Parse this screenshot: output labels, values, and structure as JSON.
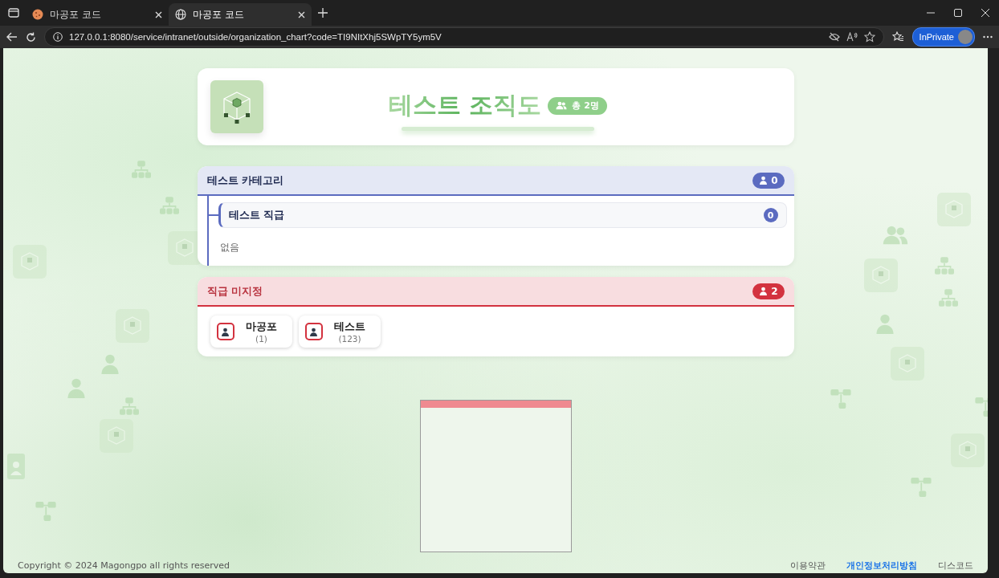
{
  "browser": {
    "tabs": [
      {
        "title": "마공포 코드",
        "kind": "cookie",
        "selected": false
      },
      {
        "title": "마공포 코드",
        "kind": "globe",
        "selected": true
      }
    ],
    "url": "127.0.0.1:8080/service/intranet/outside/organization_chart?code=TI9NItXhj5SWpTY5ym5V",
    "profile_label": "InPrivate"
  },
  "header": {
    "title": "테스트 조직도",
    "total": "총 2명"
  },
  "categories": [
    {
      "name": "테스트 카테고리",
      "count": "0",
      "positions": [
        {
          "name": "테스트 직급",
          "count": "0"
        }
      ],
      "empty_text": "없음"
    }
  ],
  "unassigned": {
    "name": "직급 미지정",
    "count": "2",
    "members": [
      {
        "name": "마공포",
        "id": "(1)"
      },
      {
        "name": "테스트",
        "id": "(123)"
      }
    ]
  },
  "footer": {
    "copyright": "Copyright © 2024 Magongpo all rights reserved",
    "links": [
      {
        "label": "이용약관",
        "active": false
      },
      {
        "label": "개인정보처리방침",
        "active": true
      },
      {
        "label": "디스코드",
        "active": false
      }
    ]
  }
}
